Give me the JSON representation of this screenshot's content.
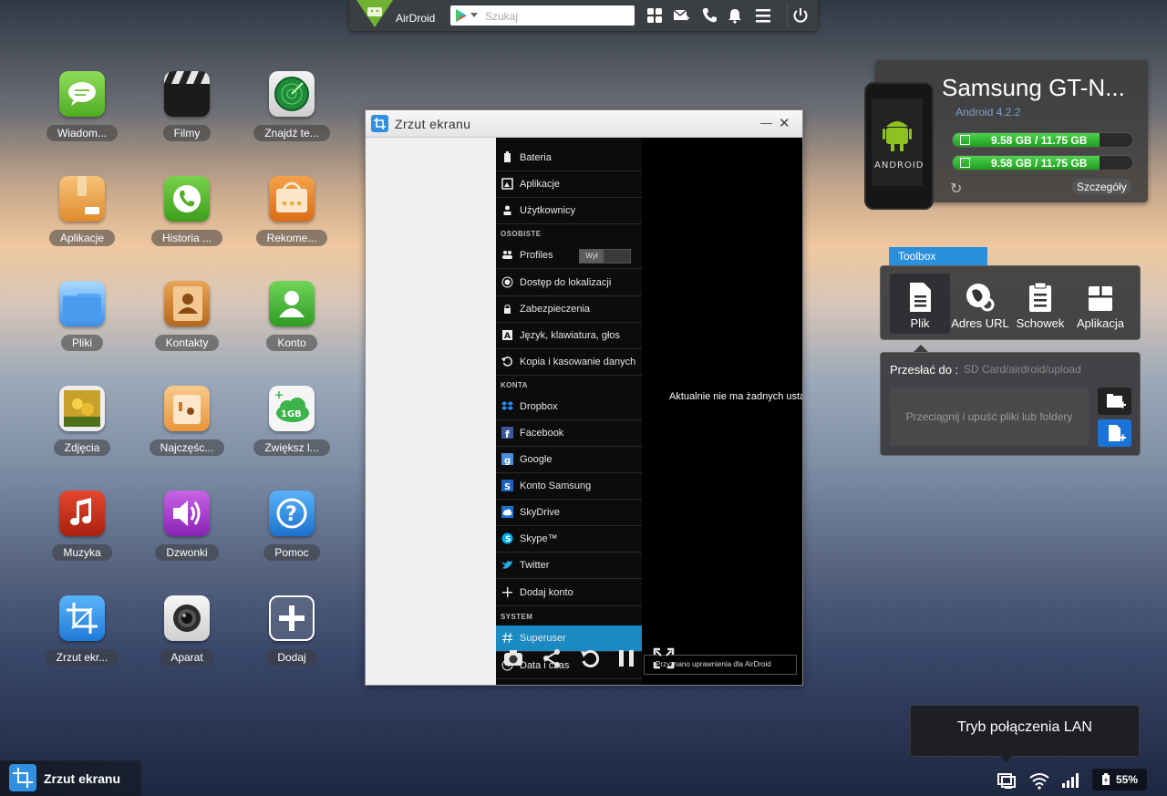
{
  "topbar": {
    "brand": "AirDroid",
    "search_placeholder": "Szukaj"
  },
  "desktop": {
    "apps": [
      {
        "name": "messages",
        "label": "Wiadom..."
      },
      {
        "name": "movies",
        "label": "Filmy"
      },
      {
        "name": "find-phone",
        "label": "Znajdź te..."
      },
      {
        "name": "apps",
        "label": "Aplikacje"
      },
      {
        "name": "call-history",
        "label": "Historia ..."
      },
      {
        "name": "recommended",
        "label": "Rekome..."
      },
      {
        "name": "files",
        "label": "Pliki"
      },
      {
        "name": "contacts",
        "label": "Kontakty"
      },
      {
        "name": "account",
        "label": "Konto"
      },
      {
        "name": "photos",
        "label": "Zdjęcia"
      },
      {
        "name": "frequent-contacts",
        "label": "Najczęśc..."
      },
      {
        "name": "increase-storage",
        "label": "Zwiększ l..."
      },
      {
        "name": "music",
        "label": "Muzyka"
      },
      {
        "name": "ringtones",
        "label": "Dzwonki"
      },
      {
        "name": "help",
        "label": "Pomoc"
      },
      {
        "name": "screenshot",
        "label": "Zrzut ekr..."
      },
      {
        "name": "camera",
        "label": "Aparat"
      },
      {
        "name": "add",
        "label": "Dodaj"
      }
    ]
  },
  "window": {
    "title": "Zrzut ekranu",
    "menu": {
      "items_top": [
        "Bateria",
        "Aplikacje",
        "Użytkownicy"
      ],
      "section_personal": "OSOBISTE",
      "items_personal": [
        "Profiles",
        "Dostęp do lokalizacji",
        "Zabezpieczenia",
        "Język, klawiatura, głos",
        "Kopia i kasowanie danych"
      ],
      "profiles_toggle": "Wył",
      "section_accounts": "KONTA",
      "items_accounts": [
        "Dropbox",
        "Facebook",
        "Google",
        "Konto Samsung",
        "SkyDrive",
        "Skype™",
        "Twitter",
        "Dodaj konto"
      ],
      "section_system": "SYSTEM",
      "items_system": [
        "Superuser",
        "Data i czas"
      ]
    },
    "empty_text": "Aktualnie nie ma żadnych usta",
    "toast": "Przyznano uprawnienia dla AirDroid"
  },
  "device": {
    "name": "Samsung GT-N...",
    "os": "Android 4.2.2",
    "storage1": "9.58 GB / 11.75 GB",
    "storage1_used_fraction": 0.815,
    "storage2": "9.58 GB / 11.75 GB",
    "storage2_used_fraction": 0.815,
    "details": "Szczegóły"
  },
  "toolbox": {
    "title": "Toolbox",
    "tools": [
      "Plik",
      "Adres URL",
      "Schowek",
      "Aplikacja"
    ],
    "upload_label": "Przesłać do :",
    "upload_path": "SD Card/airdroid/upload",
    "drop_hint": "Przeciągnij i upuść pliki lub foldery"
  },
  "lan": {
    "text": "Tryb połączenia LAN"
  },
  "taskbar": {
    "label": "Zrzut ekranu",
    "battery": "55%"
  },
  "colors": {
    "accent": "#2a8fdd",
    "storage_green": "#3cc83c",
    "topbar": "#3b3f44"
  }
}
